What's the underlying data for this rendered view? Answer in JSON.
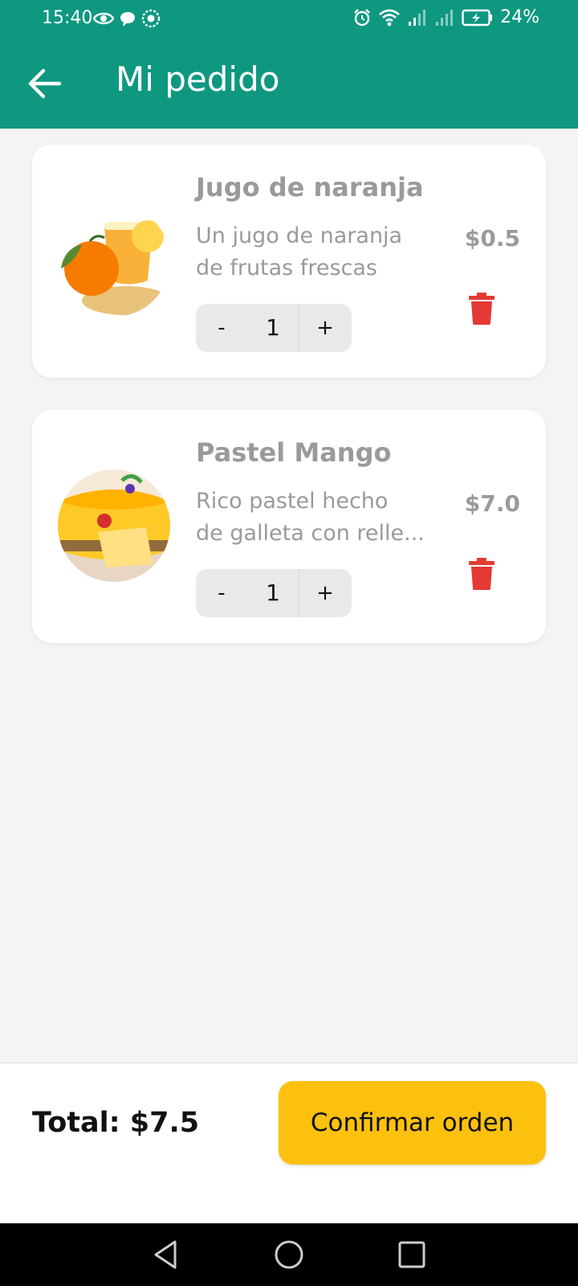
{
  "status_bar": {
    "time": "15:40",
    "battery_pct": "24%",
    "icons": [
      "eye-icon",
      "chat-bubble-icon",
      "settings-badge-icon",
      "alarm-icon",
      "wifi-icon",
      "signal-icon",
      "signal-icon",
      "battery-charging-icon"
    ]
  },
  "app_bar": {
    "title": "Mi pedido",
    "back_icon": "arrow-left-icon",
    "background": "#0f9880"
  },
  "order_items": [
    {
      "name": "Jugo de naranja",
      "description_lines": [
        "Un jugo de naranja",
        "de frutas frescas"
      ],
      "price": "$0.5",
      "quantity": "1",
      "minus_label": "-",
      "plus_label": "+",
      "image": "orange-juice-photo",
      "delete_icon": "trash-icon"
    },
    {
      "name": "Pastel Mango",
      "description_lines": [
        "Rico pastel hecho",
        "de galleta con relle..."
      ],
      "price": "$7.0",
      "quantity": "1",
      "minus_label": "-",
      "plus_label": "+",
      "image": "mango-cake-photo",
      "delete_icon": "trash-icon"
    }
  ],
  "footer": {
    "total": "Total: $7.5",
    "confirm_label": "Confirmar orden",
    "confirm_color": "#fcc10f"
  },
  "nav_bar": {
    "buttons": [
      "back-triangle-icon",
      "home-circle-icon",
      "recents-square-icon"
    ]
  },
  "colors": {
    "delete": "#e53935",
    "muted_text": "#9a9a9a"
  }
}
